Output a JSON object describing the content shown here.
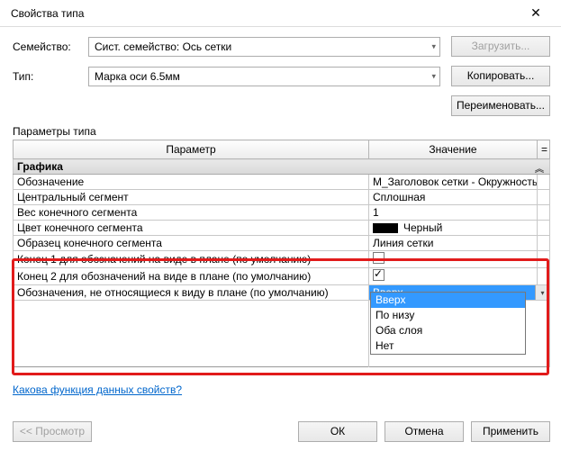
{
  "window": {
    "title": "Свойства типа"
  },
  "labels": {
    "family": "Семейство:",
    "type": "Тип:",
    "params_section": "Параметры типа"
  },
  "fields": {
    "family_value": "Сист. семейство: Ось сетки",
    "type_value": "Марка оси 6.5мм"
  },
  "buttons": {
    "load": "Загрузить...",
    "copy": "Копировать...",
    "rename": "Переименовать...",
    "preview": "<< Просмотр",
    "ok": "ОК",
    "cancel": "Отмена",
    "apply": "Применить"
  },
  "grid": {
    "col_param": "Параметр",
    "col_value": "Значение",
    "col_eq": "=",
    "group_graphics": "Графика",
    "rows": {
      "r0": {
        "p": "Обозначение",
        "v": "M_Заголовок сетки - Окружность"
      },
      "r1": {
        "p": "Центральный сегмент",
        "v": "Сплошная"
      },
      "r2": {
        "p": "Вес конечного сегмента",
        "v": "1"
      },
      "r3": {
        "p": "Цвет конечного сегмента",
        "v": "Черный"
      },
      "r4": {
        "p": "Образец конечного сегмента",
        "v": "Линия сетки"
      },
      "r5": {
        "p": "Конец 1 для обозначений на виде в плане (по умолчанию)"
      },
      "r6": {
        "p": "Конец 2 для обозначений на виде в плане (по умолчанию)"
      },
      "r7": {
        "p": "Обозначения, не относящиеся к виду в плане (по умолчанию)",
        "v": "Вверх"
      }
    }
  },
  "dropdown": {
    "o0": "Вверх",
    "o1": "По низу",
    "o2": "Оба слоя",
    "o3": "Нет"
  },
  "link": "Какова функция данных свойств?"
}
